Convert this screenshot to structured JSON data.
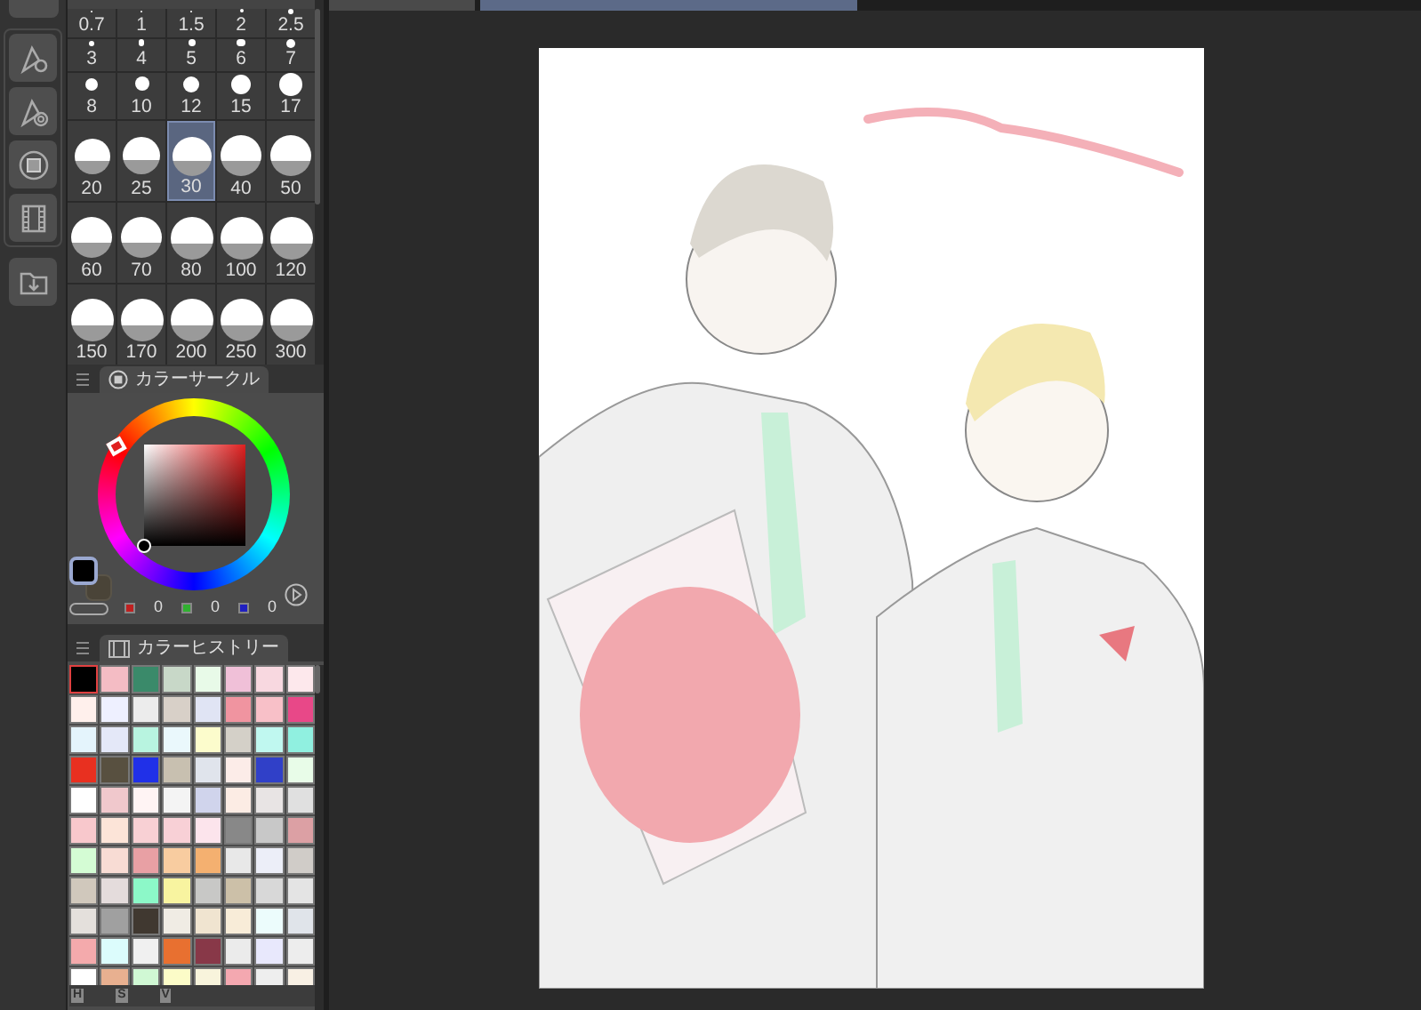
{
  "document_tabs": [
    {
      "selected": false
    },
    {
      "selected": true
    }
  ],
  "brush_sizes": [
    {
      "label": "0.7",
      "selected": false
    },
    {
      "label": "1",
      "selected": false
    },
    {
      "label": "1.5",
      "selected": false
    },
    {
      "label": "2",
      "selected": false
    },
    {
      "label": "2.5",
      "selected": false
    },
    {
      "label": "3",
      "selected": false
    },
    {
      "label": "4",
      "selected": false
    },
    {
      "label": "5",
      "selected": false
    },
    {
      "label": "6",
      "selected": false
    },
    {
      "label": "7",
      "selected": false
    },
    {
      "label": "8",
      "selected": false
    },
    {
      "label": "10",
      "selected": false
    },
    {
      "label": "12",
      "selected": false
    },
    {
      "label": "15",
      "selected": false
    },
    {
      "label": "17",
      "selected": false
    },
    {
      "label": "20",
      "selected": false
    },
    {
      "label": "25",
      "selected": false
    },
    {
      "label": "30",
      "selected": true
    },
    {
      "label": "40",
      "selected": false
    },
    {
      "label": "50",
      "selected": false
    },
    {
      "label": "60",
      "selected": false
    },
    {
      "label": "70",
      "selected": false
    },
    {
      "label": "80",
      "selected": false
    },
    {
      "label": "100",
      "selected": false
    },
    {
      "label": "120",
      "selected": false
    },
    {
      "label": "150",
      "selected": false
    },
    {
      "label": "170",
      "selected": false
    },
    {
      "label": "200",
      "selected": false
    },
    {
      "label": "250",
      "selected": false
    },
    {
      "label": "300",
      "selected": false
    }
  ],
  "color_circle": {
    "title": "カラーサークル",
    "r": "0",
    "g": "0",
    "b": "0"
  },
  "color_history": {
    "title": "カラーヒストリー",
    "swatches": [
      {
        "color": "#000000",
        "selected": true
      },
      {
        "color": "#f4bcc4",
        "selected": false
      },
      {
        "color": "#3a8a6a",
        "selected": false
      },
      {
        "color": "#c8d8c8",
        "selected": false
      },
      {
        "color": "#e8fae8",
        "selected": false
      },
      {
        "color": "#f0c0d8",
        "selected": false
      },
      {
        "color": "#f8d8e0",
        "selected": false
      },
      {
        "color": "#fde8ec",
        "selected": false
      },
      {
        "color": "#fff0ec",
        "selected": false
      },
      {
        "color": "#eef0ff",
        "selected": false
      },
      {
        "color": "#ececec",
        "selected": false
      },
      {
        "color": "#d8d0c8",
        "selected": false
      },
      {
        "color": "#e0e4f4",
        "selected": false
      },
      {
        "color": "#f094a0",
        "selected": false
      },
      {
        "color": "#f8c0c8",
        "selected": false
      },
      {
        "color": "#e84888",
        "selected": false
      },
      {
        "color": "#e4f4fc",
        "selected": false
      },
      {
        "color": "#e4e8f8",
        "selected": false
      },
      {
        "color": "#b8f4e0",
        "selected": false
      },
      {
        "color": "#eaf8fc",
        "selected": false
      },
      {
        "color": "#fcfccc",
        "selected": false
      },
      {
        "color": "#d4d0c8",
        "selected": false
      },
      {
        "color": "#c0f8f0",
        "selected": false
      },
      {
        "color": "#90f0e0",
        "selected": false
      },
      {
        "color": "#e83020",
        "selected": false
      },
      {
        "color": "#585040",
        "selected": false
      },
      {
        "color": "#2030e8",
        "selected": false
      },
      {
        "color": "#c8c0b0",
        "selected": false
      },
      {
        "color": "#e0e4ec",
        "selected": false
      },
      {
        "color": "#fcece8",
        "selected": false
      },
      {
        "color": "#3040c8",
        "selected": false
      },
      {
        "color": "#e8fce8",
        "selected": false
      },
      {
        "color": "#ffffff",
        "selected": false
      },
      {
        "color": "#f0c8cc",
        "selected": false
      },
      {
        "color": "#fff4f4",
        "selected": false
      },
      {
        "color": "#f4f4f4",
        "selected": false
      },
      {
        "color": "#d0d4ec",
        "selected": false
      },
      {
        "color": "#fcece4",
        "selected": false
      },
      {
        "color": "#e8e4e4",
        "selected": false
      },
      {
        "color": "#e0e0e0",
        "selected": false
      },
      {
        "color": "#f8c8cc",
        "selected": false
      },
      {
        "color": "#fce4d8",
        "selected": false
      },
      {
        "color": "#f8d0d4",
        "selected": false
      },
      {
        "color": "#f8d0d6",
        "selected": false
      },
      {
        "color": "#fce4ec",
        "selected": false
      },
      {
        "color": "#888888",
        "selected": false
      },
      {
        "color": "#c8c8c8",
        "selected": false
      },
      {
        "color": "#dca0a4",
        "selected": false
      },
      {
        "color": "#d4fcd4",
        "selected": false
      },
      {
        "color": "#f8dcd4",
        "selected": false
      },
      {
        "color": "#e8a0a4",
        "selected": false
      },
      {
        "color": "#f8cca0",
        "selected": false
      },
      {
        "color": "#f4b070",
        "selected": false
      },
      {
        "color": "#e8e8e8",
        "selected": false
      },
      {
        "color": "#eceef8",
        "selected": false
      },
      {
        "color": "#d0ccc8",
        "selected": false
      },
      {
        "color": "#d0c8bc",
        "selected": false
      },
      {
        "color": "#e4dcdc",
        "selected": false
      },
      {
        "color": "#8cf8c8",
        "selected": false
      },
      {
        "color": "#f8f4a0",
        "selected": false
      },
      {
        "color": "#c8c8c6",
        "selected": false
      },
      {
        "color": "#ccc0a8",
        "selected": false
      },
      {
        "color": "#d8d8d8",
        "selected": false
      },
      {
        "color": "#e4e4e4",
        "selected": false
      },
      {
        "color": "#e4e0dc",
        "selected": false
      },
      {
        "color": "#a0a0a0",
        "selected": false
      },
      {
        "color": "#403830",
        "selected": false
      },
      {
        "color": "#f0ece4",
        "selected": false
      },
      {
        "color": "#f0e4d0",
        "selected": false
      },
      {
        "color": "#f8ecd8",
        "selected": false
      },
      {
        "color": "#ecfcfc",
        "selected": false
      },
      {
        "color": "#e0e4ea",
        "selected": false
      },
      {
        "color": "#f4aaac",
        "selected": false
      },
      {
        "color": "#dcfcfc",
        "selected": false
      },
      {
        "color": "#f0f0f0",
        "selected": false
      },
      {
        "color": "#e87030",
        "selected": false
      },
      {
        "color": "#883848",
        "selected": false
      },
      {
        "color": "#ebebeb",
        "selected": false
      },
      {
        "color": "#e8e8fc",
        "selected": false
      },
      {
        "color": "#ededed",
        "selected": false
      },
      {
        "color": "#ffffff",
        "selected": false
      },
      {
        "color": "#e8b090",
        "selected": false
      },
      {
        "color": "#d0f8d4",
        "selected": false
      },
      {
        "color": "#fcfcc8",
        "selected": false
      },
      {
        "color": "#f8f4dc",
        "selected": false
      },
      {
        "color": "#f4a8b0",
        "selected": false
      },
      {
        "color": "#eeeeee",
        "selected": false
      },
      {
        "color": "#f8f0e4",
        "selected": false
      }
    ],
    "sliders": [
      "H",
      "S",
      "V"
    ]
  }
}
